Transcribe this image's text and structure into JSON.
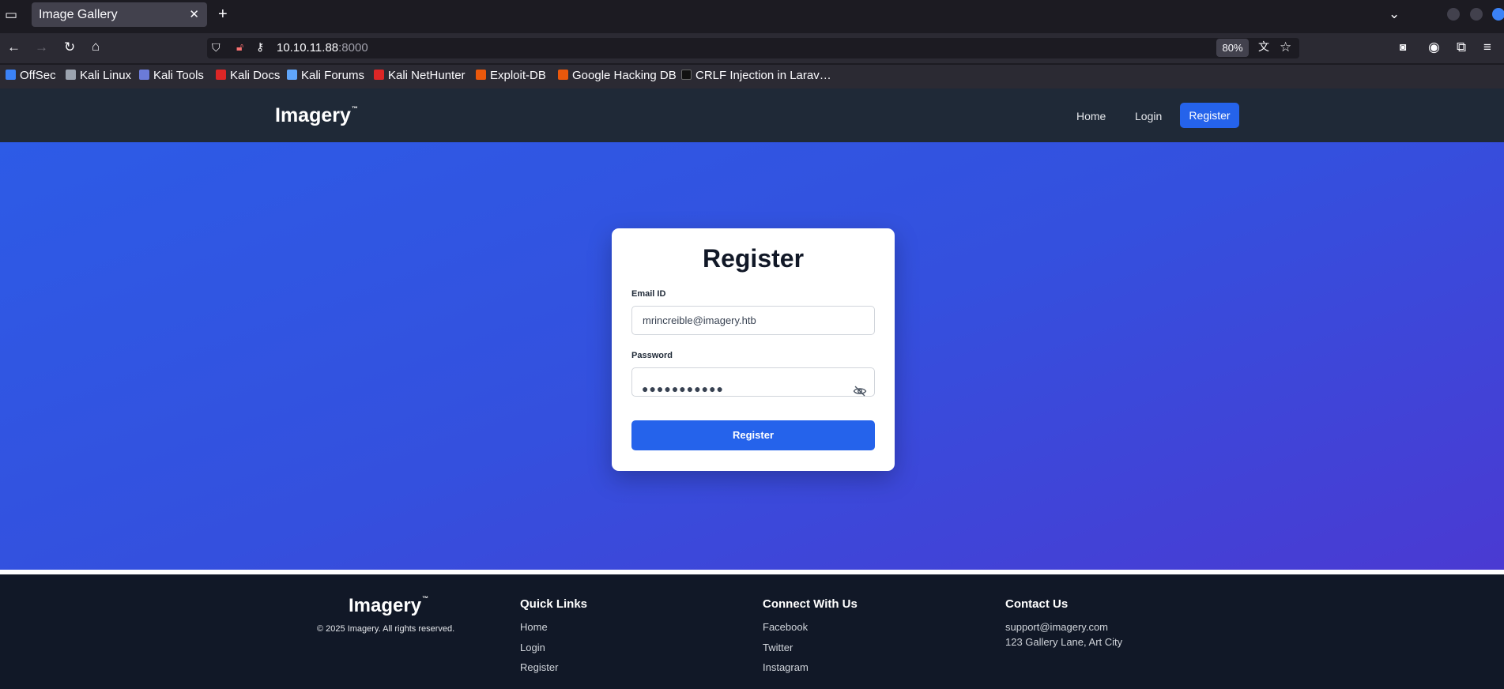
{
  "browser": {
    "tab_title": "Image Gallery",
    "tab_close": "✕",
    "new_tab": "+",
    "url_host": "10.10.11.88",
    "url_port": ":8000",
    "zoom": "80%",
    "bookmarks": [
      {
        "label": "OffSec",
        "color": "#3b82f6"
      },
      {
        "label": "Kali Linux",
        "color": "#9ca3af"
      },
      {
        "label": "Kali Tools",
        "color": "#6b7bd8"
      },
      {
        "label": "Kali Docs",
        "color": "#dc2626"
      },
      {
        "label": "Kali Forums",
        "color": "#60a5fa"
      },
      {
        "label": "Kali NetHunter",
        "color": "#dc2626"
      },
      {
        "label": "Exploit-DB",
        "color": "#ea580c"
      },
      {
        "label": "Google Hacking DB",
        "color": "#ea580c"
      },
      {
        "label": "CRLF Injection in Larav…",
        "color": "#111111"
      }
    ]
  },
  "header": {
    "brand": "Imagery",
    "tm": "™",
    "nav": {
      "home": "Home",
      "login": "Login",
      "register": "Register"
    }
  },
  "register": {
    "title": "Register",
    "email_label": "Email ID",
    "email_value": "mrincreible@imagery.htb",
    "password_label": "Password",
    "password_masked": "●●●●●●●●●●●",
    "submit_label": "Register"
  },
  "footer": {
    "brand": "Imagery",
    "tm": "™",
    "copyright": "© 2025 Imagery. All rights reserved.",
    "quick_links": {
      "heading": "Quick Links",
      "items": [
        "Home",
        "Login",
        "Register"
      ]
    },
    "connect": {
      "heading": "Connect With Us",
      "items": [
        "Facebook",
        "Twitter",
        "Instagram"
      ]
    },
    "contact": {
      "heading": "Contact Us",
      "email": "support@imagery.com",
      "address": "123 Gallery Lane, Art City"
    }
  },
  "colors": {
    "accent": "#2563eb",
    "header_bg": "#1f2937",
    "footer_bg": "#111827"
  }
}
